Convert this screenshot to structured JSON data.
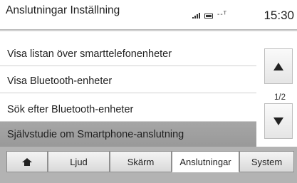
{
  "header": {
    "title": "Anslutningar Inställning",
    "network_text": "--ᵀ",
    "time": "15:30"
  },
  "list": {
    "items": [
      {
        "label": "Visa listan över smarttelefonenheter",
        "selected": false
      },
      {
        "label": "Visa Bluetooth-enheter",
        "selected": false
      },
      {
        "label": "Sök efter Bluetooth-enheter",
        "selected": false
      },
      {
        "label": "Självstudie om Smartphone-anslutning",
        "selected": true
      }
    ]
  },
  "scroll": {
    "page_indicator": "1/2",
    "up_icon": "triangle-up-icon",
    "down_icon": "triangle-down-icon"
  },
  "tabs": {
    "home_icon": "home-icon",
    "items": [
      {
        "label": "Ljud",
        "active": false
      },
      {
        "label": "Skärm",
        "active": false
      },
      {
        "label": "Anslutningar",
        "active": true
      },
      {
        "label": "System",
        "active": false
      }
    ]
  },
  "colors": {
    "selected_row": "#a0a0a0",
    "tabbar_bg": "#b3b3b3",
    "active_tab": "#ffffff"
  }
}
